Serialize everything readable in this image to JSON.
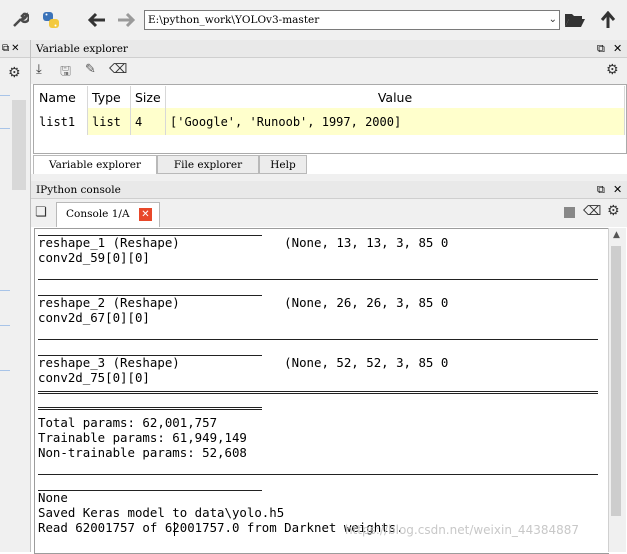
{
  "toolbar": {
    "path": "E:\\python_work\\YOLOv3-master",
    "icons": [
      "wrench-icon",
      "python-icon",
      "back-arrow-icon",
      "forward-arrow-icon",
      "folder-open-icon",
      "up-arrow-icon"
    ]
  },
  "variable_explorer": {
    "title": "Variable explorer",
    "columns": [
      "Name",
      "Type",
      "Size",
      "Value"
    ],
    "rows": [
      {
        "name": "list1",
        "type": "list",
        "size": "4",
        "value": "['Google', 'Runoob', 1997, 2000]"
      }
    ],
    "tabs": [
      "Variable explorer",
      "File explorer",
      "Help"
    ]
  },
  "ipython": {
    "title": "IPython console",
    "console_tab": "Console 1/A"
  },
  "console_lines": {
    "l1": "reshape_1 (Reshape)              (None, 13, 13, 3, 85 0",
    "l2": "conv2d_59[0][0]",
    "l3": "reshape_2 (Reshape)              (None, 26, 26, 3, 85 0",
    "l4": "conv2d_67[0][0]",
    "l5": "reshape_3 (Reshape)              (None, 52, 52, 3, 85 0",
    "l6": "conv2d_75[0][0]",
    "l7": "Total params: 62,001,757",
    "l8": "Trainable params: 61,949,149",
    "l9": "Non-trainable params: 52,608",
    "l10": "None",
    "l11": "Saved Keras model to data\\yolo.h5",
    "l12": "Read 62001757 of 62001757.0 from Darknet weights."
  },
  "watermark": "https://blog.csdn.net/weixin_44384887"
}
